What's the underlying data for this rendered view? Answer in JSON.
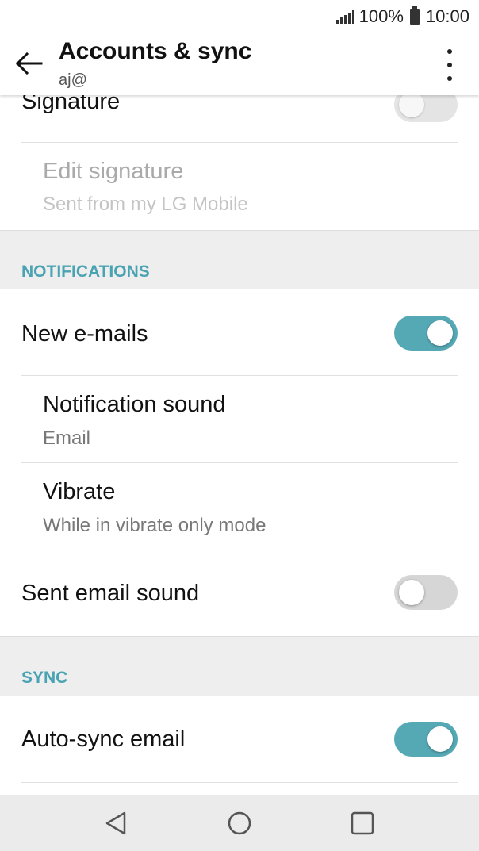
{
  "status_bar": {
    "battery_percent": "100%",
    "time": "10:00",
    "signal_icon": "signal-icon",
    "battery_icon": "battery-icon"
  },
  "app_bar": {
    "title": "Accounts & sync",
    "subtitle": "aj@",
    "back_icon": "back-arrow-icon",
    "menu_icon": "overflow-menu-icon"
  },
  "settings": {
    "signature": {
      "label": "Signature",
      "enabled": false
    },
    "edit_signature": {
      "label": "Edit signature",
      "value": "Sent from my LG Mobile"
    }
  },
  "notifications": {
    "header": "NOTIFICATIONS",
    "new_emails": {
      "label": "New e-mails",
      "enabled": true
    },
    "notification_sound": {
      "label": "Notification sound",
      "value": "Email"
    },
    "vibrate": {
      "label": "Vibrate",
      "value": "While in vibrate only mode"
    },
    "sent_email_sound": {
      "label": "Sent email sound",
      "enabled": false
    }
  },
  "sync": {
    "header": "SYNC",
    "auto_sync_email": {
      "label": "Auto-sync email",
      "enabled": true
    }
  },
  "nav_bar": {
    "back_icon": "nav-back-icon",
    "home_icon": "nav-home-icon",
    "recents_icon": "nav-recents-icon"
  },
  "colors": {
    "accent": "#4aa3b2",
    "toggle_on": "#55a9b5",
    "toggle_off": "#d6d6d6",
    "section_bg": "#eeeeee"
  }
}
